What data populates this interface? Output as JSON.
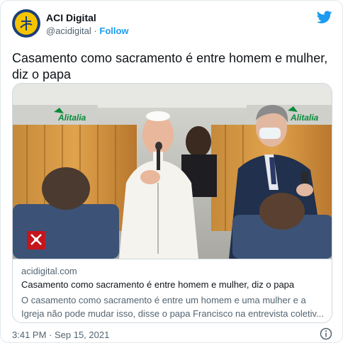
{
  "account": {
    "name": "ACI Digital",
    "handle": "@acidigital",
    "separator": "·",
    "follow_label": "Follow"
  },
  "tweet": {
    "text": "Casamento como sacramento é entre homem e mulher, diz o papa",
    "timestamp": "3:41 PM · Sep 15, 2021"
  },
  "card": {
    "airline_text": "Alitalia",
    "domain": "acidigital.com",
    "title": "Casamento como sacramento é entre homem e mulher, diz o papa",
    "description": "O casamento como sacramento é entre um homem e uma mulher e a Igreja não pode mudar isso, disse o papa Francisco na entrevista coletiv..."
  },
  "colors": {
    "twitter_blue": "#1d9bf0",
    "text_primary": "#0f1419",
    "text_secondary": "#536471",
    "border": "#cfd9de"
  },
  "icons": {
    "brand": "twitter-bird-icon",
    "info": "info-icon",
    "avatar_logo": "cross-logo-icon",
    "vatican": "vatican-keys-icon"
  }
}
